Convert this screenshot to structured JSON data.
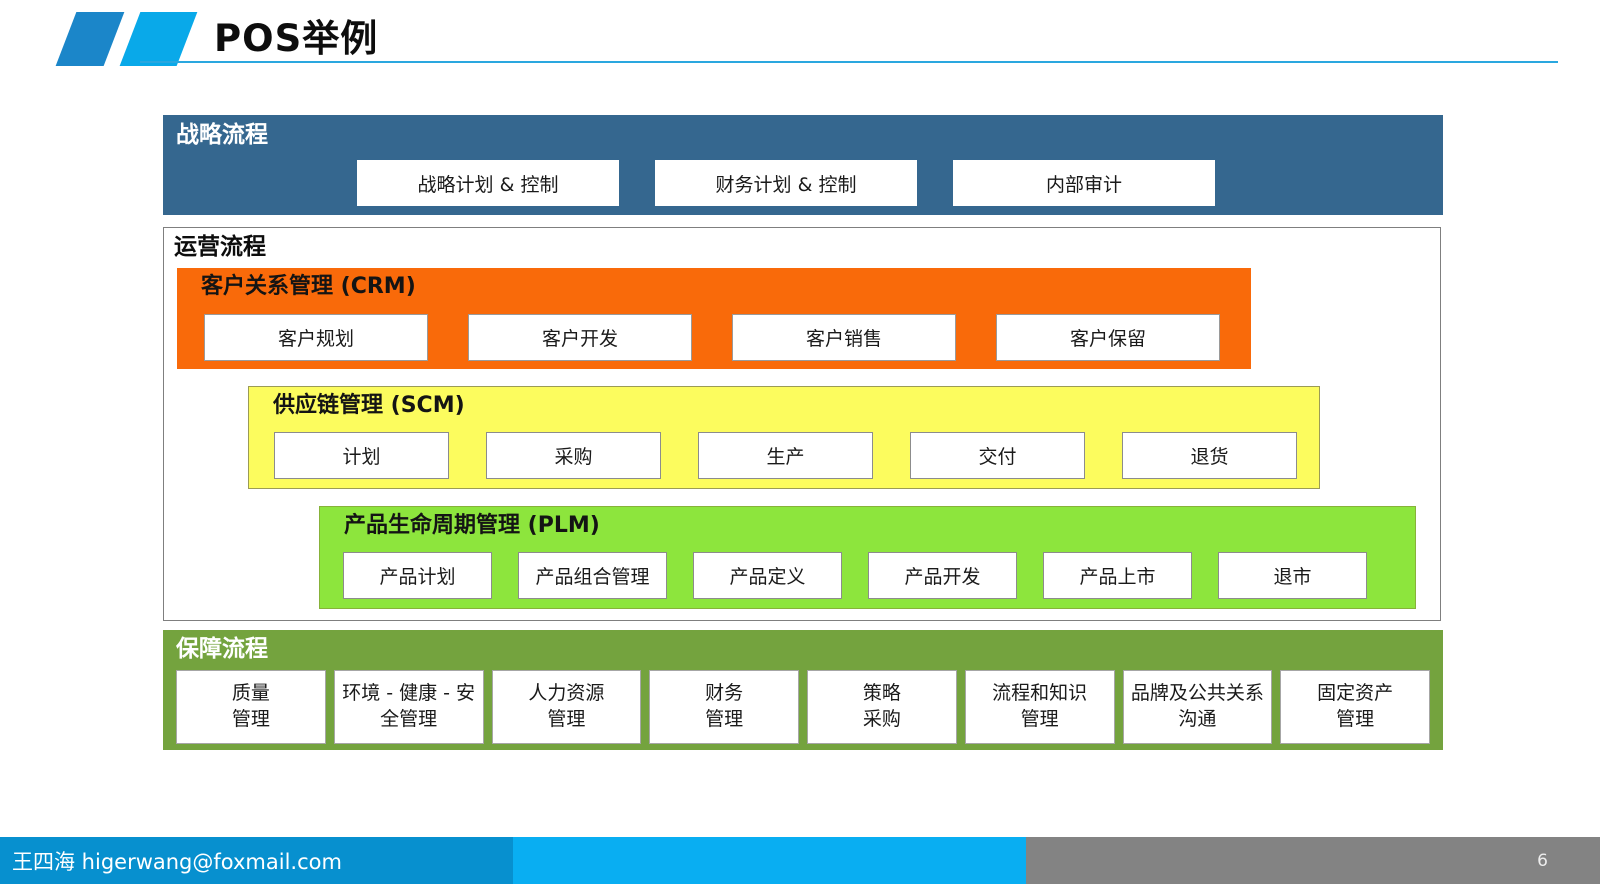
{
  "slide": {
    "title": "POS举例",
    "page_number": "6",
    "footer_text": "王四海 higerwang@foxmail.com"
  },
  "colors": {
    "steel_blue": "#35678F",
    "orange": "#F96A0A",
    "yellow": "#FCFC5E",
    "lime_green": "#8DE53D",
    "olive_green": "#74A33E",
    "footer_dark_blue": "#0790CF",
    "footer_light_blue": "#09AEF2",
    "footer_gray": "#838383",
    "logo_blue_dark": "#1B86C9",
    "logo_blue_light": "#09A9E9",
    "header_line_blue": "#2AA7DF"
  },
  "icons": {
    "logo": "dual-parallelogram-logo"
  },
  "sections": {
    "strategic": {
      "label": "战略流程",
      "boxes": [
        "战略计划 & 控制",
        "财务计划 & 控制",
        "内部审计"
      ]
    },
    "operations": {
      "label": "运营流程",
      "groups": [
        {
          "label": "客户关系管理 (CRM)",
          "boxes": [
            "客户规划",
            "客户开发",
            "客户销售",
            "客户保留"
          ]
        },
        {
          "label": "供应链管理 (SCM)",
          "boxes": [
            "计划",
            "采购",
            "生产",
            "交付",
            "退货"
          ]
        },
        {
          "label": "产品生命周期管理 (PLM)",
          "boxes": [
            "产品计划",
            "产品组合管理",
            "产品定义",
            "产品开发",
            "产品上市",
            "退市"
          ]
        }
      ]
    },
    "support": {
      "label": "保障流程",
      "boxes": [
        "质量\n管理",
        "环境 - 健康 - 安\n全管理",
        "人力资源\n管理",
        "财务\n管理",
        "策略\n采购",
        "流程和知识\n管理",
        "品牌及公共关系\n沟通",
        "固定资产\n管理"
      ]
    }
  }
}
